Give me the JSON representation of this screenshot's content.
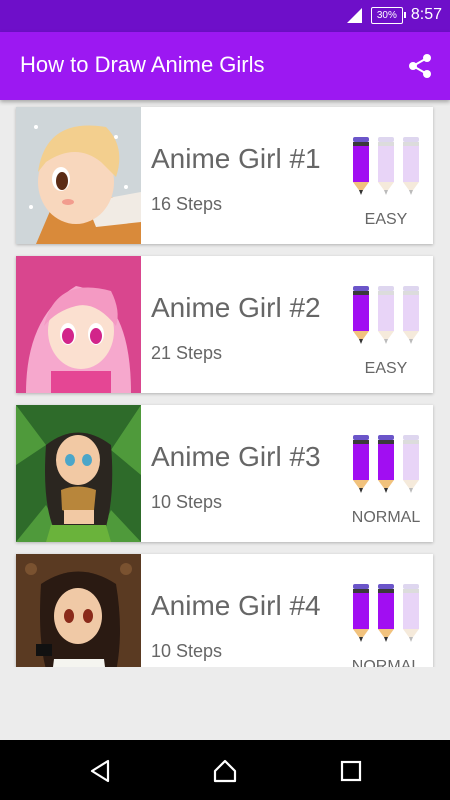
{
  "status_bar": {
    "battery": "30%",
    "time": "8:57",
    "icons": [
      "signal-icon",
      "battery-icon"
    ]
  },
  "app_bar": {
    "title": "How to Draw Anime Girls",
    "icons": [
      "share-icon"
    ]
  },
  "colors": {
    "status_bar": "#6e0fc9",
    "app_bar": "#9c18f2",
    "pencil_active": "#a10ef2",
    "pencil_inactive": "#e8d4f7"
  },
  "tutorials": [
    {
      "name": "Anime Girl #1",
      "steps": "16 Steps",
      "level": "EASY",
      "difficulty": 1,
      "difficulty_max": 3
    },
    {
      "name": "Anime Girl #2",
      "steps": "21 Steps",
      "level": "EASY",
      "difficulty": 1,
      "difficulty_max": 3
    },
    {
      "name": "Anime Girl #3",
      "steps": "10 Steps",
      "level": "NORMAL",
      "difficulty": 2,
      "difficulty_max": 3
    },
    {
      "name": "Anime Girl #4",
      "steps": "10 Steps",
      "level": "NORMAL",
      "difficulty": 2,
      "difficulty_max": 3
    }
  ],
  "nav_bar": {
    "icons": [
      "back-icon",
      "home-icon",
      "recents-icon"
    ]
  }
}
